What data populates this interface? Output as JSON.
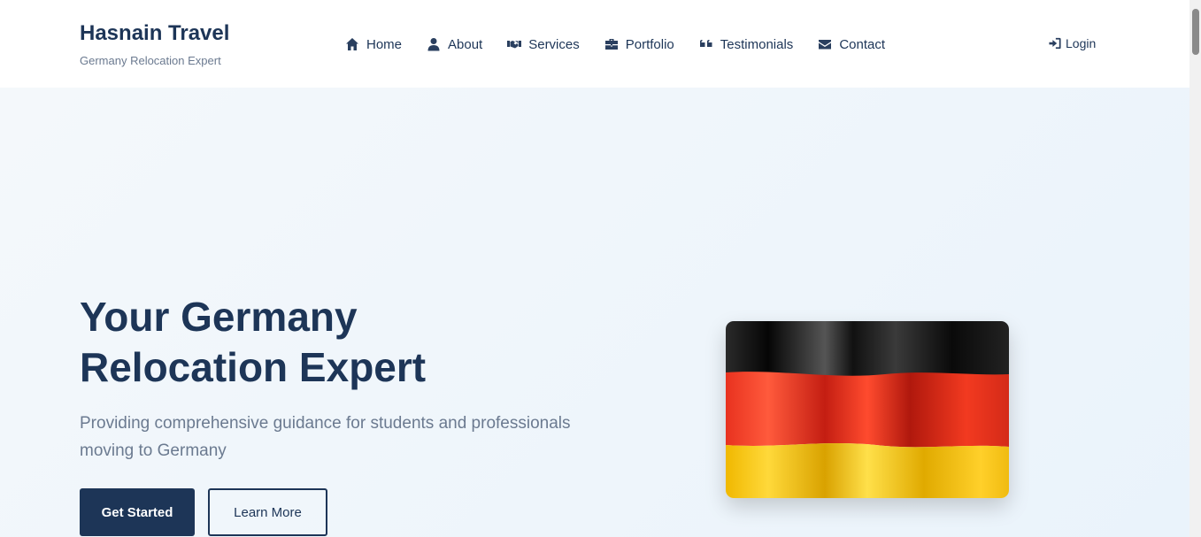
{
  "brand": {
    "title": "Hasnain Travel",
    "subtitle": "Germany Relocation Expert"
  },
  "nav": {
    "items": [
      {
        "label": "Home",
        "icon": "home-icon"
      },
      {
        "label": "About",
        "icon": "user-icon"
      },
      {
        "label": "Services",
        "icon": "handshake-icon"
      },
      {
        "label": "Portfolio",
        "icon": "briefcase-icon"
      },
      {
        "label": "Testimonials",
        "icon": "quote-icon"
      },
      {
        "label": "Contact",
        "icon": "envelope-icon"
      }
    ],
    "login_label": "Login",
    "login_icon": "sign-in-icon"
  },
  "hero": {
    "title": "Your Germany Relocation Expert",
    "subtitle": "Providing comprehensive guidance for students and professionals moving to Germany",
    "primary_button": "Get Started",
    "secondary_button": "Learn More",
    "image": "germany-flag"
  },
  "colors": {
    "brand": "#1d3557",
    "muted_text": "#6b7a90",
    "hero_bg": "#f4f8fb",
    "flag_black": "#111111",
    "flag_red": "#dd2a1b",
    "flag_gold": "#f5c518"
  }
}
